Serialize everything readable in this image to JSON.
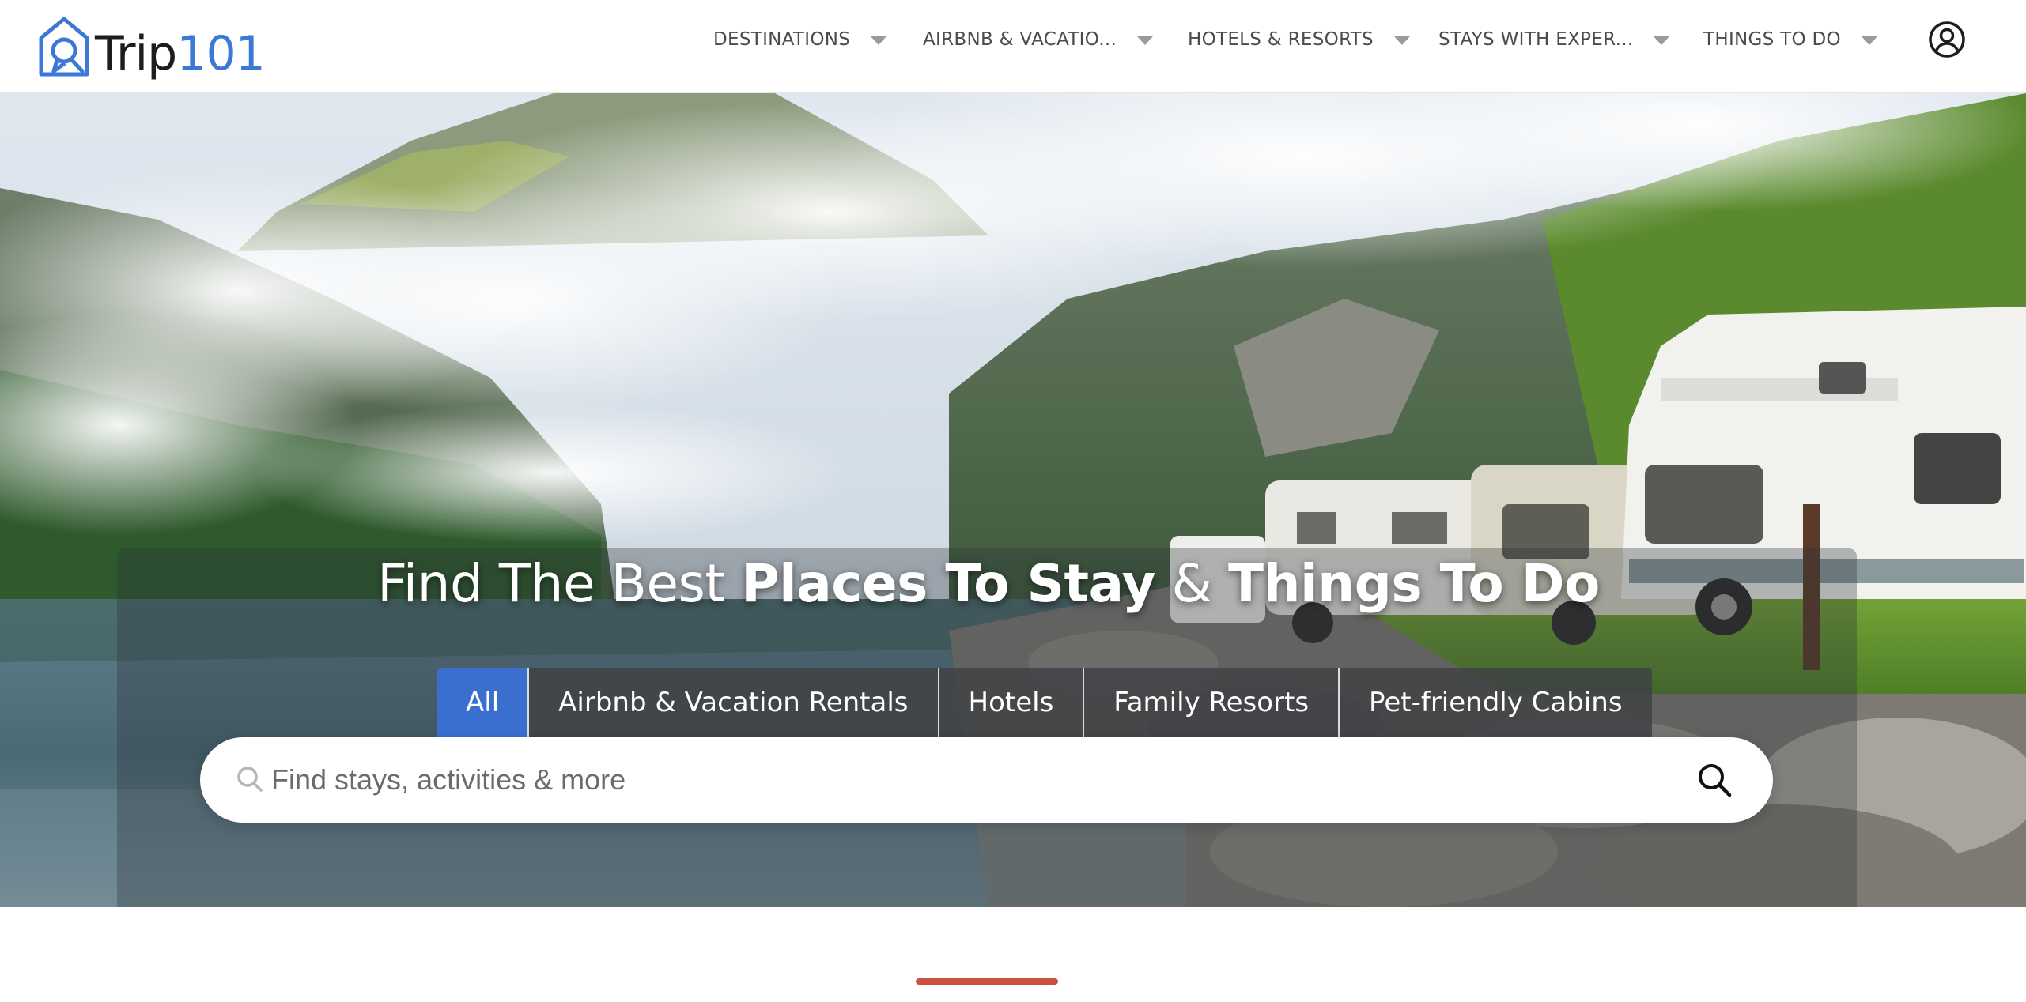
{
  "brand": {
    "name_part1": "Trip",
    "name_part2": "101",
    "primary_color": "#3b78d8",
    "logo_icon": "house-pin-icon"
  },
  "nav": {
    "items": [
      {
        "label": "DESTINATIONS"
      },
      {
        "label": "AIRBNB & VACATIO..."
      },
      {
        "label": "HOTELS & RESORTS"
      },
      {
        "label": "STAYS WITH EXPER..."
      },
      {
        "label": "THINGS TO DO"
      }
    ],
    "account_icon": "user-circle-icon"
  },
  "hero": {
    "headline_light": "Find The Best ",
    "headline_bold": "Places To Stay",
    "headline_amp": " & ",
    "headline_bold2": "Things To Do",
    "tabs": [
      {
        "label": "All",
        "active": true
      },
      {
        "label": "Airbnb & Vacation Rentals",
        "active": false
      },
      {
        "label": "Hotels",
        "active": false
      },
      {
        "label": "Family Resorts",
        "active": false
      },
      {
        "label": "Pet-friendly Cabins",
        "active": false
      }
    ],
    "search": {
      "placeholder": "Find stays, activities & more",
      "value": "",
      "button_icon": "search-icon"
    },
    "active_tab_color": "#3a6fd0"
  },
  "accent_color": "#c9533f"
}
